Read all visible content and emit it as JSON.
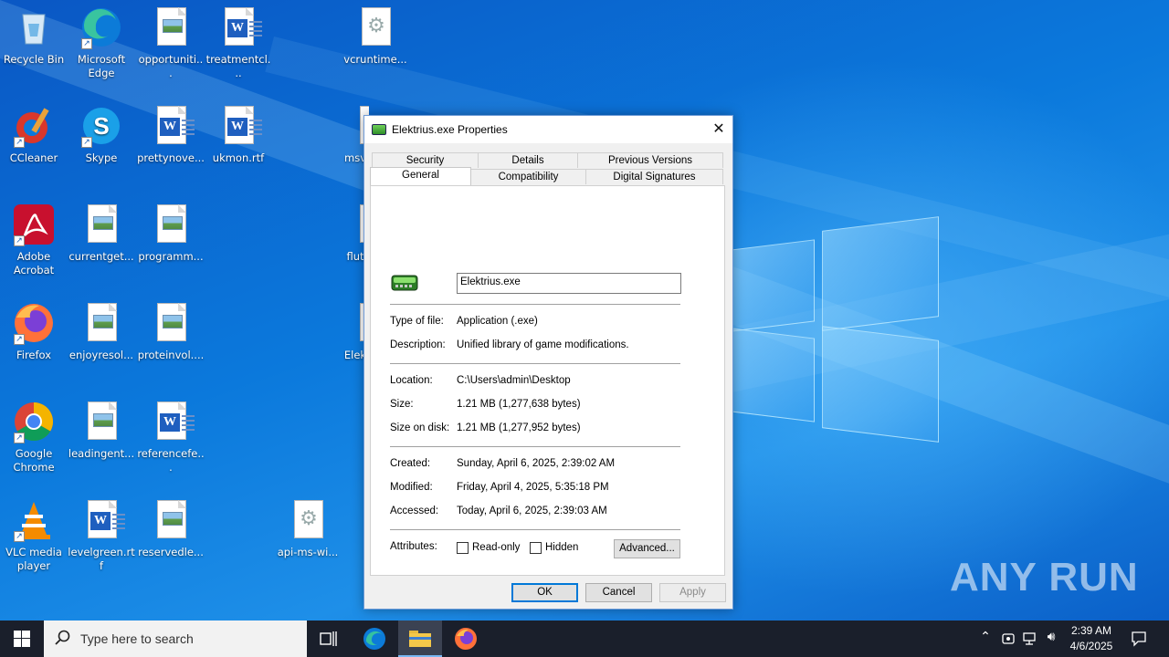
{
  "desktop": {
    "icons": [
      {
        "label": "Recycle Bin",
        "kind": "recycle-bin"
      },
      {
        "label": "Microsoft Edge",
        "kind": "edge"
      },
      {
        "label": "opportuniti...",
        "kind": "image-doc"
      },
      {
        "label": "treatmentcl...",
        "kind": "word-doc"
      },
      {
        "label": "vcruntime...",
        "kind": "system-file"
      },
      {
        "label": "CCleaner",
        "kind": "ccleaner"
      },
      {
        "label": "Skype",
        "kind": "skype"
      },
      {
        "label": "prettynove...",
        "kind": "word-doc"
      },
      {
        "label": "ukmon.rtf",
        "kind": "word-doc"
      },
      {
        "label": "msv",
        "kind": "partial"
      },
      {
        "label": "Adobe Acrobat",
        "kind": "acrobat"
      },
      {
        "label": "currentget...",
        "kind": "image-doc"
      },
      {
        "label": "programm...",
        "kind": "image-doc"
      },
      {
        "label": "flut",
        "kind": "partial"
      },
      {
        "label": "Firefox",
        "kind": "firefox"
      },
      {
        "label": "enjoyresol...",
        "kind": "image-doc"
      },
      {
        "label": "proteinvol....",
        "kind": "image-doc"
      },
      {
        "label": "Elek",
        "kind": "partial"
      },
      {
        "label": "Google Chrome",
        "kind": "chrome"
      },
      {
        "label": "leadingent...",
        "kind": "image-doc"
      },
      {
        "label": "referencefe...",
        "kind": "word-doc"
      },
      {
        "label": "VLC media player",
        "kind": "vlc"
      },
      {
        "label": "levelgreen.rtf",
        "kind": "word-doc"
      },
      {
        "label": "reservedle...",
        "kind": "image-doc"
      },
      {
        "label": "api-ms-wi...",
        "kind": "system-file"
      }
    ]
  },
  "dialog": {
    "title": "Elektrius.exe Properties",
    "close_icon": "close-icon",
    "tabs_row1": [
      "Security",
      "Details",
      "Previous Versions"
    ],
    "tabs_row2": [
      "General",
      "Compatibility",
      "Digital Signatures"
    ],
    "active_tab": "General",
    "file_name": "Elektrius.exe",
    "fields": {
      "type_label": "Type of file:",
      "type_value": "Application (.exe)",
      "desc_label": "Description:",
      "desc_value": "Unified library of game modifications.",
      "location_label": "Location:",
      "location_value": "C:\\Users\\admin\\Desktop",
      "size_label": "Size:",
      "size_value": "1.21 MB (1,277,638 bytes)",
      "sizedisk_label": "Size on disk:",
      "sizedisk_value": "1.21 MB (1,277,952 bytes)",
      "created_label": "Created:",
      "created_value": "Sunday, April 6, 2025, 2:39:02 AM",
      "modified_label": "Modified:",
      "modified_value": "Friday, April 4, 2025, 5:35:18 PM",
      "accessed_label": "Accessed:",
      "accessed_value": "Today, April 6, 2025, 2:39:03 AM",
      "attributes_label": "Attributes:"
    },
    "readonly_label": "Read-only",
    "readonly_checked": false,
    "hidden_label": "Hidden",
    "hidden_checked": false,
    "advanced_label": "Advanced...",
    "ok_label": "OK",
    "cancel_label": "Cancel",
    "apply_label": "Apply"
  },
  "taskbar": {
    "search_placeholder": "Type here to search",
    "apps": [
      "task-view",
      "edge",
      "file-explorer",
      "firefox"
    ],
    "active_app": "file-explorer",
    "clock_time": "2:39 AM",
    "clock_date": "4/6/2025"
  },
  "watermark": "ANY RUN",
  "colors": {
    "accent": "#0078d7",
    "taskbar": "#1a1f2b",
    "desktop": "#0b79dc"
  }
}
